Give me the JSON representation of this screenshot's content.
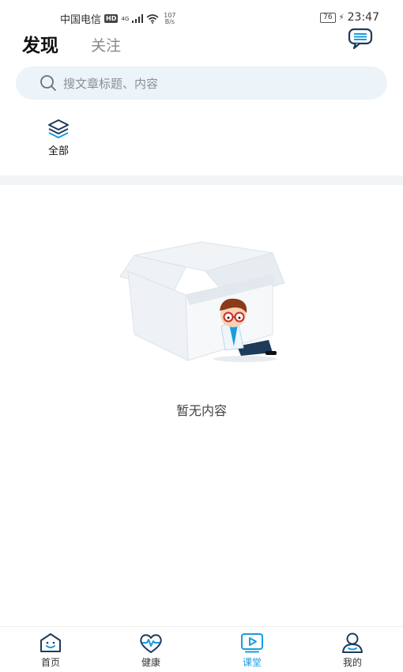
{
  "status_bar": {
    "carrier": "中国电信",
    "hd": "HD",
    "signal": "4G",
    "speed_value": "107",
    "speed_unit": "B/s",
    "battery": "76",
    "time": "23:47"
  },
  "header": {
    "tab_active": "发现",
    "tab_inactive": "关注"
  },
  "search": {
    "placeholder": "搜文章标题、内容"
  },
  "categories": [
    {
      "label": "全部"
    }
  ],
  "empty_state": {
    "text": "暂无内容"
  },
  "bottom_nav": {
    "items": [
      {
        "label": "首页",
        "icon": "home-face-icon",
        "active": false
      },
      {
        "label": "健康",
        "icon": "heart-pulse-icon",
        "active": false
      },
      {
        "label": "课堂",
        "icon": "video-play-icon",
        "active": true
      },
      {
        "label": "我的",
        "icon": "person-icon",
        "active": false
      }
    ]
  },
  "colors": {
    "accent": "#1a9be0",
    "search_bg": "#ecf3f9",
    "text_primary": "#111111",
    "text_secondary": "#888888"
  }
}
